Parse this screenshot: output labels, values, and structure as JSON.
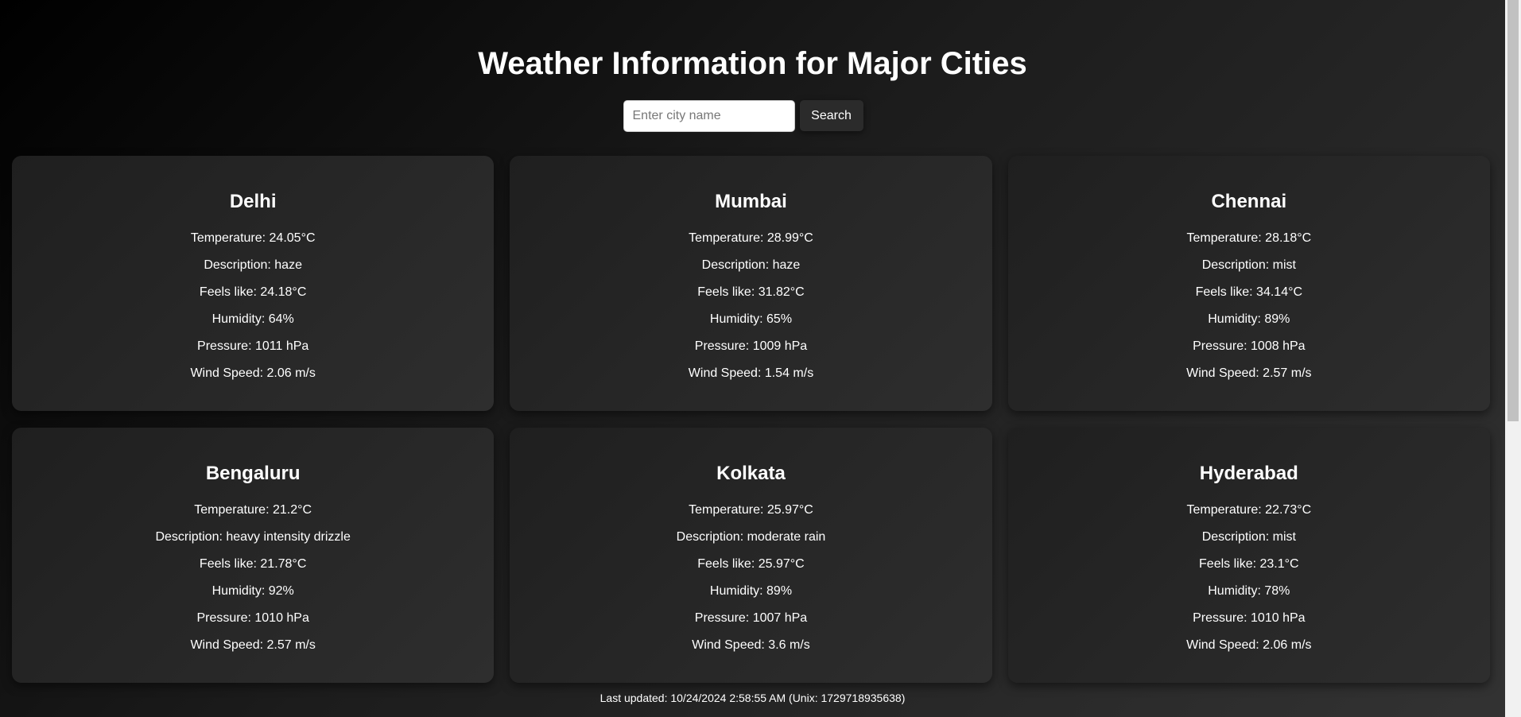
{
  "header": {
    "title": "Weather Information for Major Cities"
  },
  "search": {
    "placeholder": "Enter city name",
    "value": "",
    "button_label": "Search"
  },
  "cities": [
    {
      "name": "Delhi",
      "temperature": "Temperature: 24.05°C",
      "description": "Description: haze",
      "feels_like": "Feels like: 24.18°C",
      "humidity": "Humidity: 64%",
      "pressure": "Pressure: 1011 hPa",
      "wind": "Wind Speed: 2.06 m/s"
    },
    {
      "name": "Mumbai",
      "temperature": "Temperature: 28.99°C",
      "description": "Description: haze",
      "feels_like": "Feels like: 31.82°C",
      "humidity": "Humidity: 65%",
      "pressure": "Pressure: 1009 hPa",
      "wind": "Wind Speed: 1.54 m/s"
    },
    {
      "name": "Chennai",
      "temperature": "Temperature: 28.18°C",
      "description": "Description: mist",
      "feels_like": "Feels like: 34.14°C",
      "humidity": "Humidity: 89%",
      "pressure": "Pressure: 1008 hPa",
      "wind": "Wind Speed: 2.57 m/s"
    },
    {
      "name": "Bengaluru",
      "temperature": "Temperature: 21.2°C",
      "description": "Description: heavy intensity drizzle",
      "feels_like": "Feels like: 21.78°C",
      "humidity": "Humidity: 92%",
      "pressure": "Pressure: 1010 hPa",
      "wind": "Wind Speed: 2.57 m/s"
    },
    {
      "name": "Kolkata",
      "temperature": "Temperature: 25.97°C",
      "description": "Description: moderate rain",
      "feels_like": "Feels like: 25.97°C",
      "humidity": "Humidity: 89%",
      "pressure": "Pressure: 1007 hPa",
      "wind": "Wind Speed: 3.6 m/s"
    },
    {
      "name": "Hyderabad",
      "temperature": "Temperature: 22.73°C",
      "description": "Description: mist",
      "feels_like": "Feels like: 23.1°C",
      "humidity": "Humidity: 78%",
      "pressure": "Pressure: 1010 hPa",
      "wind": "Wind Speed: 2.06 m/s"
    }
  ],
  "footer": {
    "last_updated": "Last updated: 10/24/2024 2:58:55 AM (Unix: 1729718935638)"
  }
}
